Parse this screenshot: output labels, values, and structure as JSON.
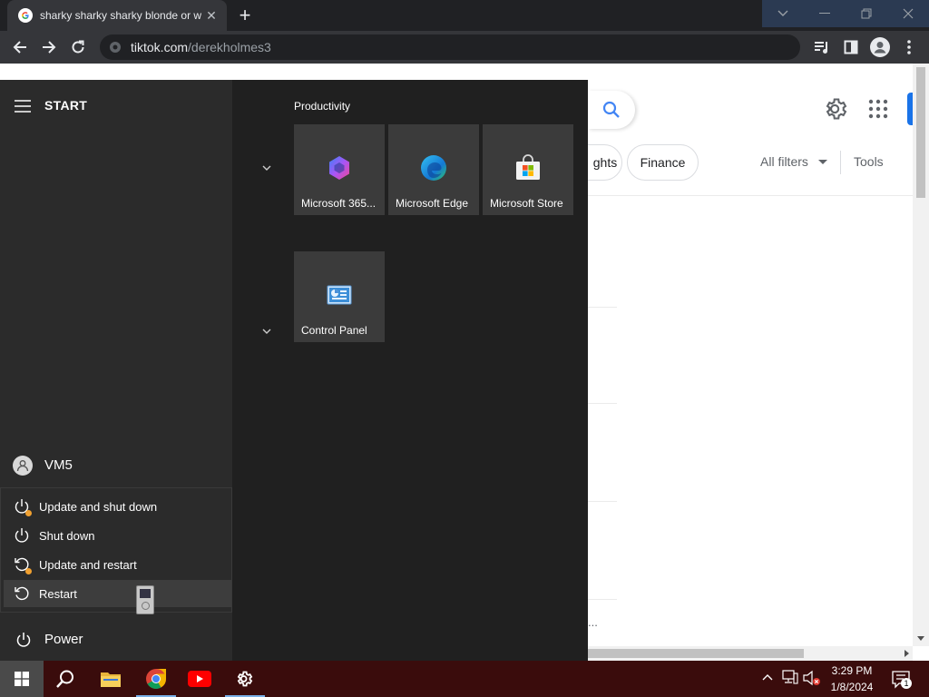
{
  "browser": {
    "tab_title": "sharky sharky sharky blonde or w",
    "tab_close": "✕",
    "new_tab": "+",
    "url_host": "tiktok.com",
    "url_path": "/derekholmes3"
  },
  "page": {
    "chip_insights": "ghts",
    "chip_finance": "Finance",
    "all_filters": "All filters",
    "tools": "Tools",
    "ellipsis": "..."
  },
  "start_menu": {
    "header": "START",
    "user_name": "VM5",
    "power_label": "Power",
    "power_options": [
      {
        "label": "Update and shut down"
      },
      {
        "label": "Shut down"
      },
      {
        "label": "Update and restart"
      },
      {
        "label": "Restart"
      }
    ],
    "group_title": "Productivity",
    "tiles": [
      {
        "label": "Microsoft 365...",
        "icon": "microsoft-365-icon"
      },
      {
        "label": "Microsoft Edge",
        "icon": "edge-icon"
      },
      {
        "label": "Microsoft Store",
        "icon": "store-icon"
      },
      {
        "label": "Control Panel",
        "icon": "control-panel-icon"
      }
    ]
  },
  "taskbar": {
    "time": "3:29 PM",
    "date": "1/8/2024",
    "notification_count": "1"
  },
  "colors": {
    "start_left": "#2b2b2b",
    "start_right": "#202020",
    "tile": "#3b3b3b",
    "taskbar": "#3a0c0c",
    "chrome_dark": "#202124",
    "accent_blue": "#1a73e8"
  }
}
